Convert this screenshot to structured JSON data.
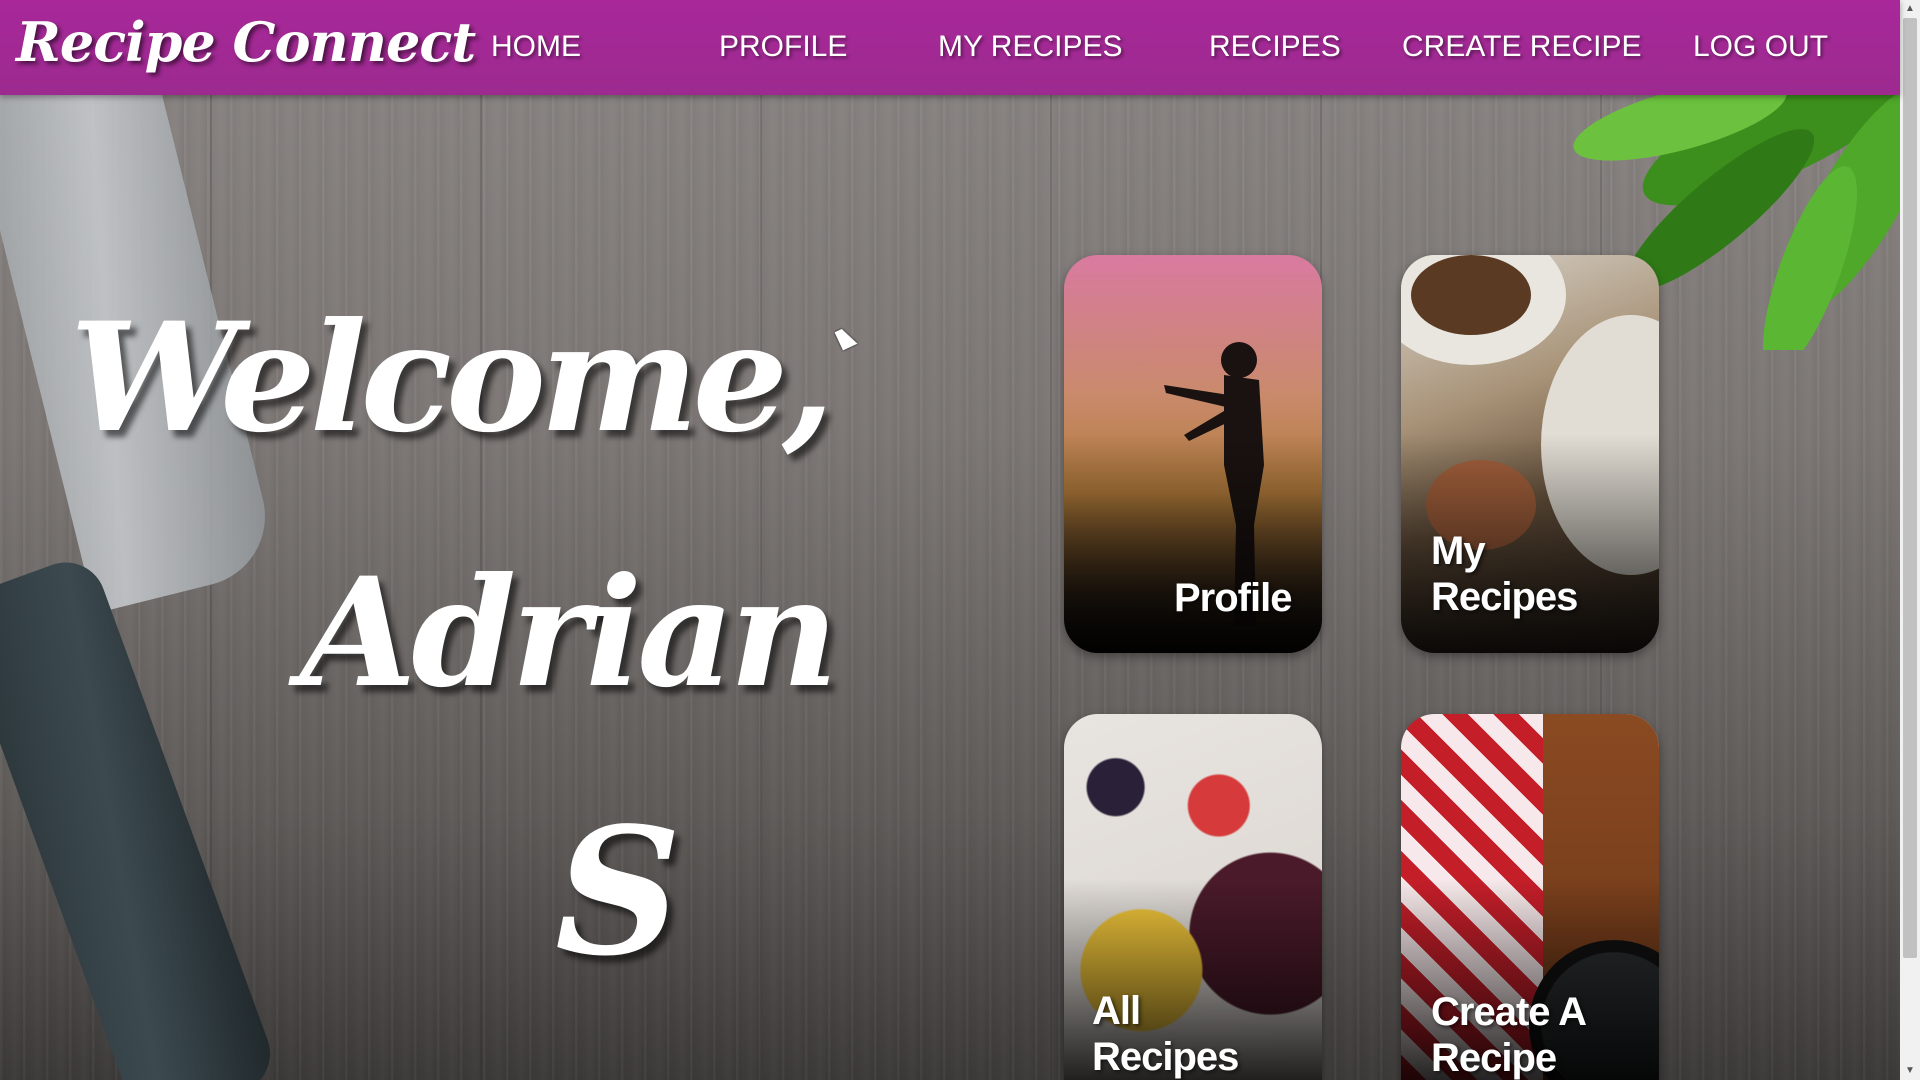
{
  "nav": {
    "logo": "Recipe Connect",
    "links": [
      "HOME",
      "PROFILE",
      "MY RECIPES",
      "RECIPES",
      "CREATE RECIPE",
      "LOG OUT"
    ]
  },
  "welcome": {
    "line1": "Welcome,",
    "line2": "Adrian",
    "line3": "S"
  },
  "cards": {
    "profile": "Profile",
    "my_recipes_1": "My",
    "my_recipes_2": "Recipes",
    "all_recipes_1": "All",
    "all_recipes_2": "Recipes",
    "create_recipe_1": "Create A",
    "create_recipe_2": "Recipe"
  },
  "colors": {
    "nav_bg": "#a8289a",
    "text": "#ffffff"
  }
}
